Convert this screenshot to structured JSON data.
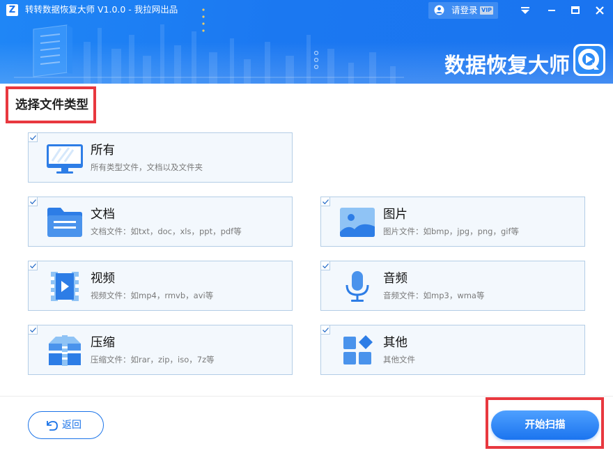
{
  "window": {
    "title": "转转数据恢复大师 V1.0.0 - 我拉网出品",
    "logo_letter": "Z",
    "login_label": "请登录",
    "vip_badge": "VIP",
    "controls": [
      "menu-dropdown-icon",
      "minimize-icon",
      "maximize-icon",
      "close-icon"
    ]
  },
  "banner": {
    "brand_text": "数据恢复大师"
  },
  "section": {
    "title": "选择文件类型"
  },
  "file_types": [
    {
      "name": "所有",
      "desc": "所有类型文件，文档以及文件夹",
      "icon": "monitor-icon",
      "checked": true
    },
    {
      "name": "文档",
      "desc": "文档文件：如txt，doc，xls，ppt，pdf等",
      "icon": "folder-icon",
      "checked": true
    },
    {
      "name": "图片",
      "desc": "图片文件：如bmp，jpg，png，gif等",
      "icon": "image-icon",
      "checked": true
    },
    {
      "name": "视频",
      "desc": "视频文件：如mp4，rmvb，avi等",
      "icon": "video-icon",
      "checked": true
    },
    {
      "name": "音频",
      "desc": "音频文件：如mp3，wma等",
      "icon": "microphone-icon",
      "checked": true
    },
    {
      "name": "压缩",
      "desc": "压缩文件：如rar，zip，iso，7z等",
      "icon": "archive-icon",
      "checked": true
    },
    {
      "name": "其他",
      "desc": "其他文件",
      "icon": "apps-icon",
      "checked": true
    }
  ],
  "footer": {
    "back_label": "返回",
    "scan_label": "开始扫描"
  },
  "colors": {
    "primary": "#1a73e8",
    "header_blue": "#1b78f1",
    "card_bg": "#f3f8fd",
    "card_border": "#b3cde6",
    "highlight_red": "#e8383f"
  }
}
